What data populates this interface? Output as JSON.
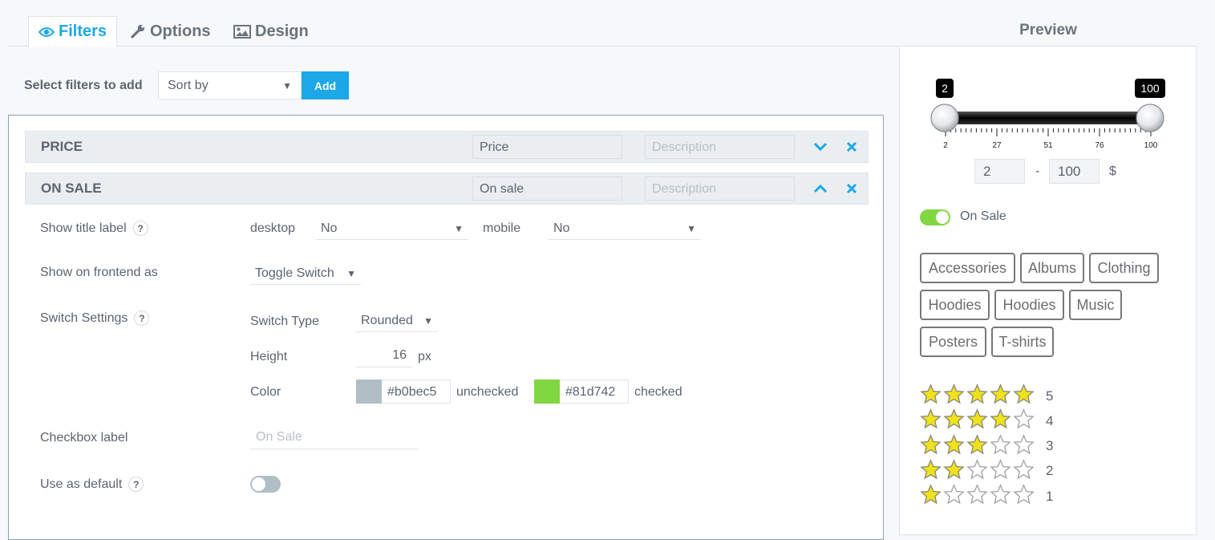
{
  "tabs": [
    {
      "label": "Filters",
      "icon": "eye-icon",
      "active": true
    },
    {
      "label": "Options",
      "icon": "wrench-icon",
      "active": false
    },
    {
      "label": "Design",
      "icon": "image-icon",
      "active": false
    }
  ],
  "add_row": {
    "label": "Select filters to add",
    "select_value": "Sort by",
    "add_label": "Add"
  },
  "filters": [
    {
      "name": "PRICE",
      "title_value": "Price",
      "description_placeholder": "Description",
      "expanded": false
    },
    {
      "name": "ON SALE",
      "title_value": "On sale",
      "description_placeholder": "Description",
      "expanded": true
    }
  ],
  "settings": {
    "show_title_label": "Show title label",
    "desktop_label": "desktop",
    "desktop_value": "No",
    "mobile_label": "mobile",
    "mobile_value": "No",
    "show_frontend_label": "Show on frontend as",
    "show_frontend_value": "Toggle Switch",
    "switch_settings_label": "Switch Settings",
    "switch_type_label": "Switch Type",
    "switch_type_value": "Rounded",
    "height_label": "Height",
    "height_value": "16",
    "height_unit": "px",
    "color_label": "Color",
    "unchecked_color": "#b0bec5",
    "unchecked_label": "unchecked",
    "checked_color": "#81d742",
    "checked_label": "checked",
    "checkbox_label": "Checkbox label",
    "checkbox_placeholder": "On Sale",
    "use_default_label": "Use as default",
    "use_default_on": false,
    "help_mark": "?"
  },
  "preview": {
    "title": "Preview",
    "slider": {
      "min": 2,
      "max": 100,
      "low_label": "2",
      "high_label": "100",
      "ticks": [
        "2",
        "27",
        "51",
        "76",
        "100"
      ],
      "from_value": "2",
      "dash": "-",
      "to_value": "100",
      "currency": "$"
    },
    "on_sale_label": "On Sale",
    "on_sale_checked": true,
    "categories": [
      "Accessories",
      "Albums",
      "Clothing",
      "Hoodies",
      "Hoodies",
      "Music",
      "Posters",
      "T-shirts"
    ],
    "ratings": [
      {
        "stars": 5,
        "label": "5"
      },
      {
        "stars": 4,
        "label": "4"
      },
      {
        "stars": 3,
        "label": "3"
      },
      {
        "stars": 2,
        "label": "2"
      },
      {
        "stars": 1,
        "label": "1"
      }
    ],
    "star_color": "#f0e21a"
  }
}
